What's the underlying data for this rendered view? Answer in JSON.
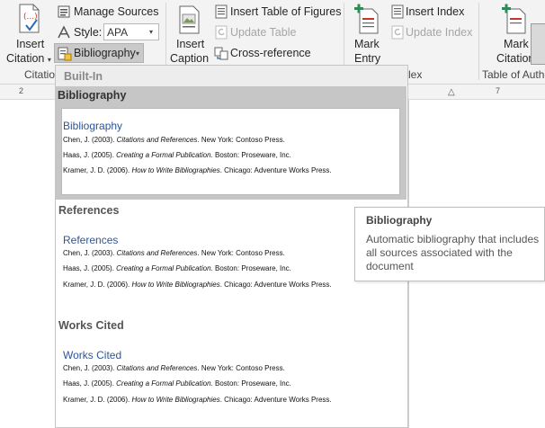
{
  "ribbon": {
    "insert_citation_line1": "Insert",
    "insert_citation_line2": "Citation",
    "manage_sources": "Manage Sources",
    "style_label": "Style:",
    "style_value": "APA",
    "bibliography_button": "Bibliography",
    "citations_group": "Citatio",
    "insert_caption_line1": "Insert",
    "insert_caption_line2": "Caption",
    "insert_table_of_figures": "Insert Table of Figures",
    "update_table": "Update Table",
    "cross_reference": "Cross-reference",
    "mark_entry_line1": "Mark",
    "mark_entry_line2": "Entry",
    "insert_index": "Insert Index",
    "update_index": "Update Index",
    "index_group": "lex",
    "mark_citation_line1": "Mark",
    "mark_citation_line2": "Citation",
    "table_of_authorities_group": "Table of Autho"
  },
  "ruler": {
    "left_mark": "2",
    "right_mark": "7"
  },
  "dropdown": {
    "builtin_header": "Built-In",
    "options": [
      {
        "header": "Bibliography",
        "title": "Bibliography",
        "entries": [
          {
            "author": "Chen, J. (2003). ",
            "work": "Citations and References",
            "rest": ". New York: Contoso Press."
          },
          {
            "author": "Haas, J. (2005). ",
            "work": "Creating a Formal Publication",
            "rest": ". Boston: Proseware, Inc."
          },
          {
            "author": "Kramer, J. D. (2006). ",
            "work": "How to Write Bibliographies",
            "rest": ". Chicago: Adventure Works Press."
          }
        ]
      },
      {
        "header": "References",
        "title": "References",
        "entries": [
          {
            "author": "Chen, J. (2003). ",
            "work": "Citations and References",
            "rest": ". New York: Contoso Press."
          },
          {
            "author": "Haas, J. (2005). ",
            "work": "Creating a Formal Publication",
            "rest": ". Boston: Proseware, Inc."
          },
          {
            "author": "Kramer, J. D. (2006). ",
            "work": "How to Write Bibliographies",
            "rest": ". Chicago: Adventure Works Press."
          }
        ]
      },
      {
        "header": "Works Cited",
        "title": "Works Cited",
        "entries": [
          {
            "author": "Chen, J. (2003). ",
            "work": "Citations and References",
            "rest": ". New York: Contoso Press."
          },
          {
            "author": "Haas, J. (2005). ",
            "work": "Creating a Formal Publication",
            "rest": ". Boston: Proseware, Inc."
          },
          {
            "author": "Kramer, J. D. (2006). ",
            "work": "How to Write Bibliographies",
            "rest": ". Chicago: Adventure Works Press."
          }
        ]
      }
    ]
  },
  "tooltip": {
    "title": "Bibliography",
    "description": "Automatic bibliography that includes all sources associated with the document"
  },
  "colors": {
    "link_blue": "#2e5597",
    "selected_band": "#c6c6c6",
    "ribbon_bg": "#f3f3f3"
  },
  "icons": [
    "insert-citation-icon",
    "manage-sources-icon",
    "style-dropdown-icon",
    "bibliography-icon",
    "insert-caption-icon",
    "table-of-figures-icon",
    "update-table-icon",
    "cross-reference-icon",
    "mark-entry-icon",
    "insert-index-icon",
    "update-index-icon",
    "mark-citation-icon"
  ]
}
